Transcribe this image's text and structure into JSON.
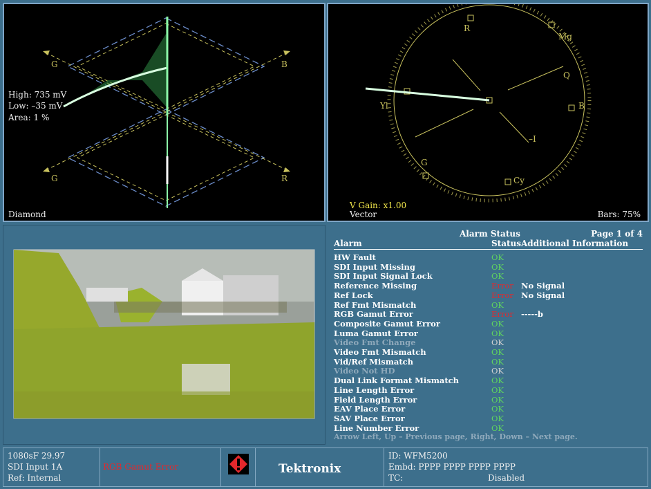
{
  "diamond": {
    "label": "Diamond",
    "high": "High: 735 mV",
    "low": "Low: –35 mV",
    "area": "Area:  1 %",
    "axis_labels": {
      "g_top": "G",
      "b": "B",
      "g_bottom": "G",
      "r": "R"
    }
  },
  "vector": {
    "label": "Vector",
    "gain": "V Gain: x1.00",
    "bars": "Bars: 75%",
    "targets": {
      "r": "R",
      "mg": "Mg",
      "b": "B",
      "q": "Q",
      "yl": "Yl",
      "i": "–I",
      "g": "G",
      "cy": "Cy"
    }
  },
  "alarms": {
    "title": "Alarm Status",
    "page": "Page 1 of 4",
    "col_alarm": "Alarm",
    "col_status": "Status",
    "col_info": "Additional Information",
    "rows": [
      {
        "name": "HW Fault",
        "status": "OK",
        "info": "",
        "state": "ok"
      },
      {
        "name": "SDI Input Missing",
        "status": "OK",
        "info": "",
        "state": "ok"
      },
      {
        "name": "SDI Input Signal Lock",
        "status": "OK",
        "info": "",
        "state": "ok"
      },
      {
        "name": "Reference Missing",
        "status": "Error",
        "info": "No Signal",
        "state": "err"
      },
      {
        "name": "Ref Lock",
        "status": "Error",
        "info": "No Signal",
        "state": "err"
      },
      {
        "name": "Ref Fmt Mismatch",
        "status": "OK",
        "info": "",
        "state": "ok"
      },
      {
        "name": "RGB Gamut Error",
        "status": "Error",
        "info": "-----b",
        "state": "err"
      },
      {
        "name": "Composite Gamut Error",
        "status": "OK",
        "info": "",
        "state": "ok"
      },
      {
        "name": "Luma Gamut Error",
        "status": "OK",
        "info": "",
        "state": "ok"
      },
      {
        "name": "Video Fmt Change",
        "status": "OK",
        "info": "",
        "state": "dim"
      },
      {
        "name": "Video Fmt Mismatch",
        "status": "OK",
        "info": "",
        "state": "ok"
      },
      {
        "name": "Vid/Ref Mismatch",
        "status": "OK",
        "info": "",
        "state": "ok"
      },
      {
        "name": "Video Not HD",
        "status": "OK",
        "info": "",
        "state": "dim"
      },
      {
        "name": "Dual Link Format Mismatch",
        "status": "OK",
        "info": "",
        "state": "ok"
      },
      {
        "name": "Line Length Error",
        "status": "OK",
        "info": "",
        "state": "ok"
      },
      {
        "name": "Field Length Error",
        "status": "OK",
        "info": "",
        "state": "ok"
      },
      {
        "name": "EAV Place Error",
        "status": "OK",
        "info": "",
        "state": "ok"
      },
      {
        "name": "SAV Place Error",
        "status": "OK",
        "info": "",
        "state": "ok"
      },
      {
        "name": "Line Number Error",
        "status": "OK",
        "info": "",
        "state": "ok"
      }
    ],
    "hint": "Arrow Left, Up – Previous page, Right, Down – Next page."
  },
  "status_bar": {
    "format": "1080sF 29.97",
    "input": "SDI Input 1A",
    "ref": "Ref: Internal",
    "error": "RGB Gamut Error",
    "brand": "Tektronix",
    "id": "ID: WFM5200",
    "embd": "Embd: PPPP PPPP PPPP PPPP",
    "tc_label": "TC:",
    "tc_value": "Disabled"
  },
  "colors": {
    "ok": "#5fd35f",
    "error": "#e4282c",
    "trace": "#7ef0a0",
    "graticule": "#c9c25e",
    "panel": "#3d6f8c"
  }
}
